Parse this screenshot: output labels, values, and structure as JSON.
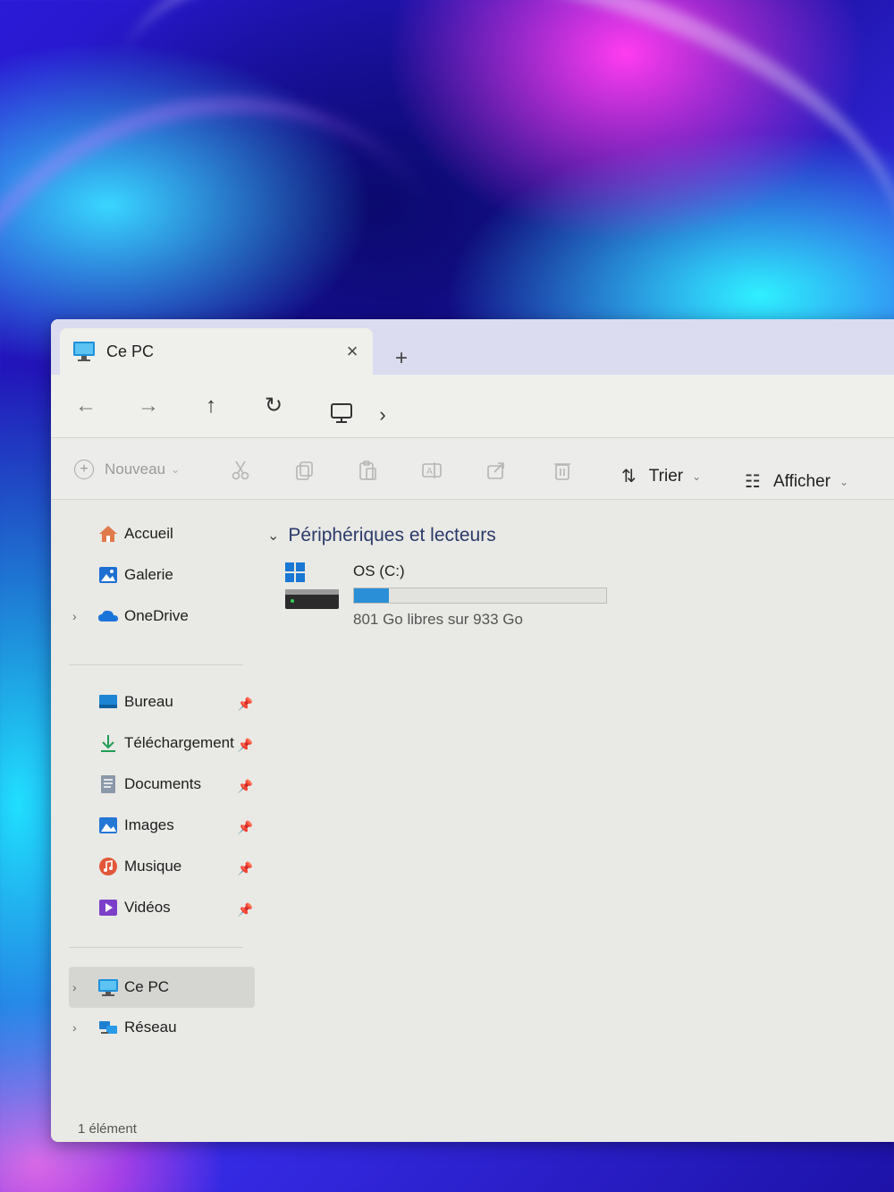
{
  "window": {
    "tab_title": "Ce PC",
    "new_tab": "+",
    "close": "×"
  },
  "nav": {
    "back": "←",
    "forward": "→",
    "up": "↑",
    "refresh": "↻",
    "breadcrumb_chevron": "›"
  },
  "toolbar": {
    "new_label": "Nouveau",
    "sort_label": "Trier",
    "view_label": "Afficher"
  },
  "sidebar": {
    "items": [
      {
        "label": "Accueil",
        "icon": "home-icon"
      },
      {
        "label": "Galerie",
        "icon": "gallery-icon"
      },
      {
        "label": "OneDrive",
        "icon": "cloud-icon"
      },
      {
        "label": "Bureau",
        "icon": "desktop-icon",
        "pinned": true
      },
      {
        "label": "Téléchargement",
        "icon": "download-icon",
        "pinned": true
      },
      {
        "label": "Documents",
        "icon": "document-icon",
        "pinned": true
      },
      {
        "label": "Images",
        "icon": "image-icon",
        "pinned": true
      },
      {
        "label": "Musique",
        "icon": "music-icon",
        "pinned": true
      },
      {
        "label": "Vidéos",
        "icon": "video-icon",
        "pinned": true
      },
      {
        "label": "Ce PC",
        "icon": "computer-icon",
        "selected": true
      },
      {
        "label": "Réseau",
        "icon": "network-icon"
      }
    ]
  },
  "content": {
    "group_title": "Périphériques et lecteurs",
    "drive": {
      "name": "OS (C:)",
      "free_text": "801 Go libres sur 933 Go",
      "used_fraction": 0.14
    }
  },
  "status": {
    "count_text": "1 élément"
  },
  "colors": {
    "accent": "#2a8fd6",
    "window_bg": "#e9e9e5",
    "tabbar_bg": "#dcdcf0"
  }
}
